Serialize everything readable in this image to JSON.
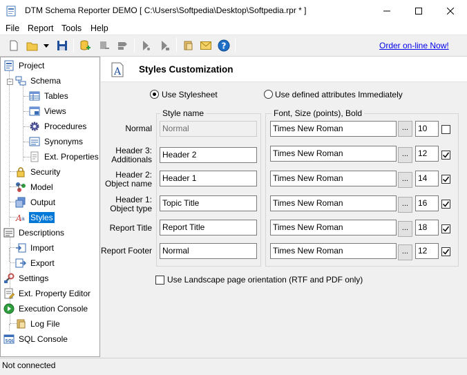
{
  "window": {
    "title": "DTM Schema Reporter DEMO  [ C:\\Users\\Softpedia\\Desktop\\Softpedia.rpr * ]"
  },
  "menu": [
    "File",
    "Report",
    "Tools",
    "Help"
  ],
  "toolbar": {
    "order_link": "Order on-line Now!",
    "icons": [
      "new-icon",
      "open-icon",
      "dropdown-icon",
      "save-icon",
      "add-db-icon",
      "remove-db-icon",
      "tag-icon",
      "run-report-icon",
      "run-report-alt-icon",
      "script-icon",
      "mail-icon",
      "help-icon"
    ]
  },
  "tree": {
    "items": [
      {
        "label": "Project",
        "icon": "project-icon",
        "level": 0
      },
      {
        "label": "Schema",
        "icon": "schema-icon",
        "level": 1
      },
      {
        "label": "Tables",
        "icon": "table-icon",
        "level": 2
      },
      {
        "label": "Views",
        "icon": "view-icon",
        "level": 2
      },
      {
        "label": "Procedures",
        "icon": "gear-icon",
        "level": 2
      },
      {
        "label": "Synonyms",
        "icon": "synonym-icon",
        "level": 2
      },
      {
        "label": "Ext. Properties",
        "icon": "properties-icon",
        "level": 2
      },
      {
        "label": "Security",
        "icon": "lock-icon",
        "level": 1
      },
      {
        "label": "Model",
        "icon": "model-icon",
        "level": 1
      },
      {
        "label": "Output",
        "icon": "output-icon",
        "level": 1
      },
      {
        "label": "Styles",
        "icon": "styles-icon",
        "level": 1,
        "selected": true
      },
      {
        "label": "Descriptions",
        "icon": "descriptions-icon",
        "level": 0
      },
      {
        "label": "Import",
        "icon": "import-icon",
        "level": 1
      },
      {
        "label": "Export",
        "icon": "export-icon",
        "level": 1
      },
      {
        "label": "Settings",
        "icon": "settings-icon",
        "level": 0
      },
      {
        "label": "Ext. Property Editor",
        "icon": "property-editor-icon",
        "level": 0
      },
      {
        "label": "Execution Console",
        "icon": "play-icon",
        "level": 0
      },
      {
        "label": "Log File",
        "icon": "log-icon",
        "level": 1
      },
      {
        "label": "SQL Console",
        "icon": "sql-icon",
        "level": 0
      }
    ]
  },
  "panel": {
    "title": "Styles Customization",
    "radio_stylesheet": "Use Stylesheet",
    "radio_defined": "Use defined attributes Immediately",
    "group_style_name": "Style name",
    "group_font": "Font, Size (points), Bold",
    "landscape_label": "Use Landscape page orientation  (RTF and PDF only)",
    "rows": [
      {
        "label": "Normal",
        "style": "Normal",
        "font": "Times New Roman",
        "size": "10",
        "bold": false,
        "disabled": true
      },
      {
        "label": "Header 3: Additionals",
        "style": "Header 2",
        "font": "Times New Roman",
        "size": "12",
        "bold": true
      },
      {
        "label": "Header 2: Object name",
        "style": "Header 1",
        "font": "Times New Roman",
        "size": "14",
        "bold": true
      },
      {
        "label": "Header 1: Object type",
        "style": "Topic Title",
        "font": "Times New Roman",
        "size": "16",
        "bold": true
      },
      {
        "label": "Report Title",
        "style": "Report Title",
        "font": "Times New Roman",
        "size": "18",
        "bold": true
      },
      {
        "label": "Report Footer",
        "style": "Normal",
        "font": "Times New Roman",
        "size": "12",
        "bold": true
      }
    ],
    "dots": "..."
  },
  "status": {
    "text": "Not connected"
  }
}
